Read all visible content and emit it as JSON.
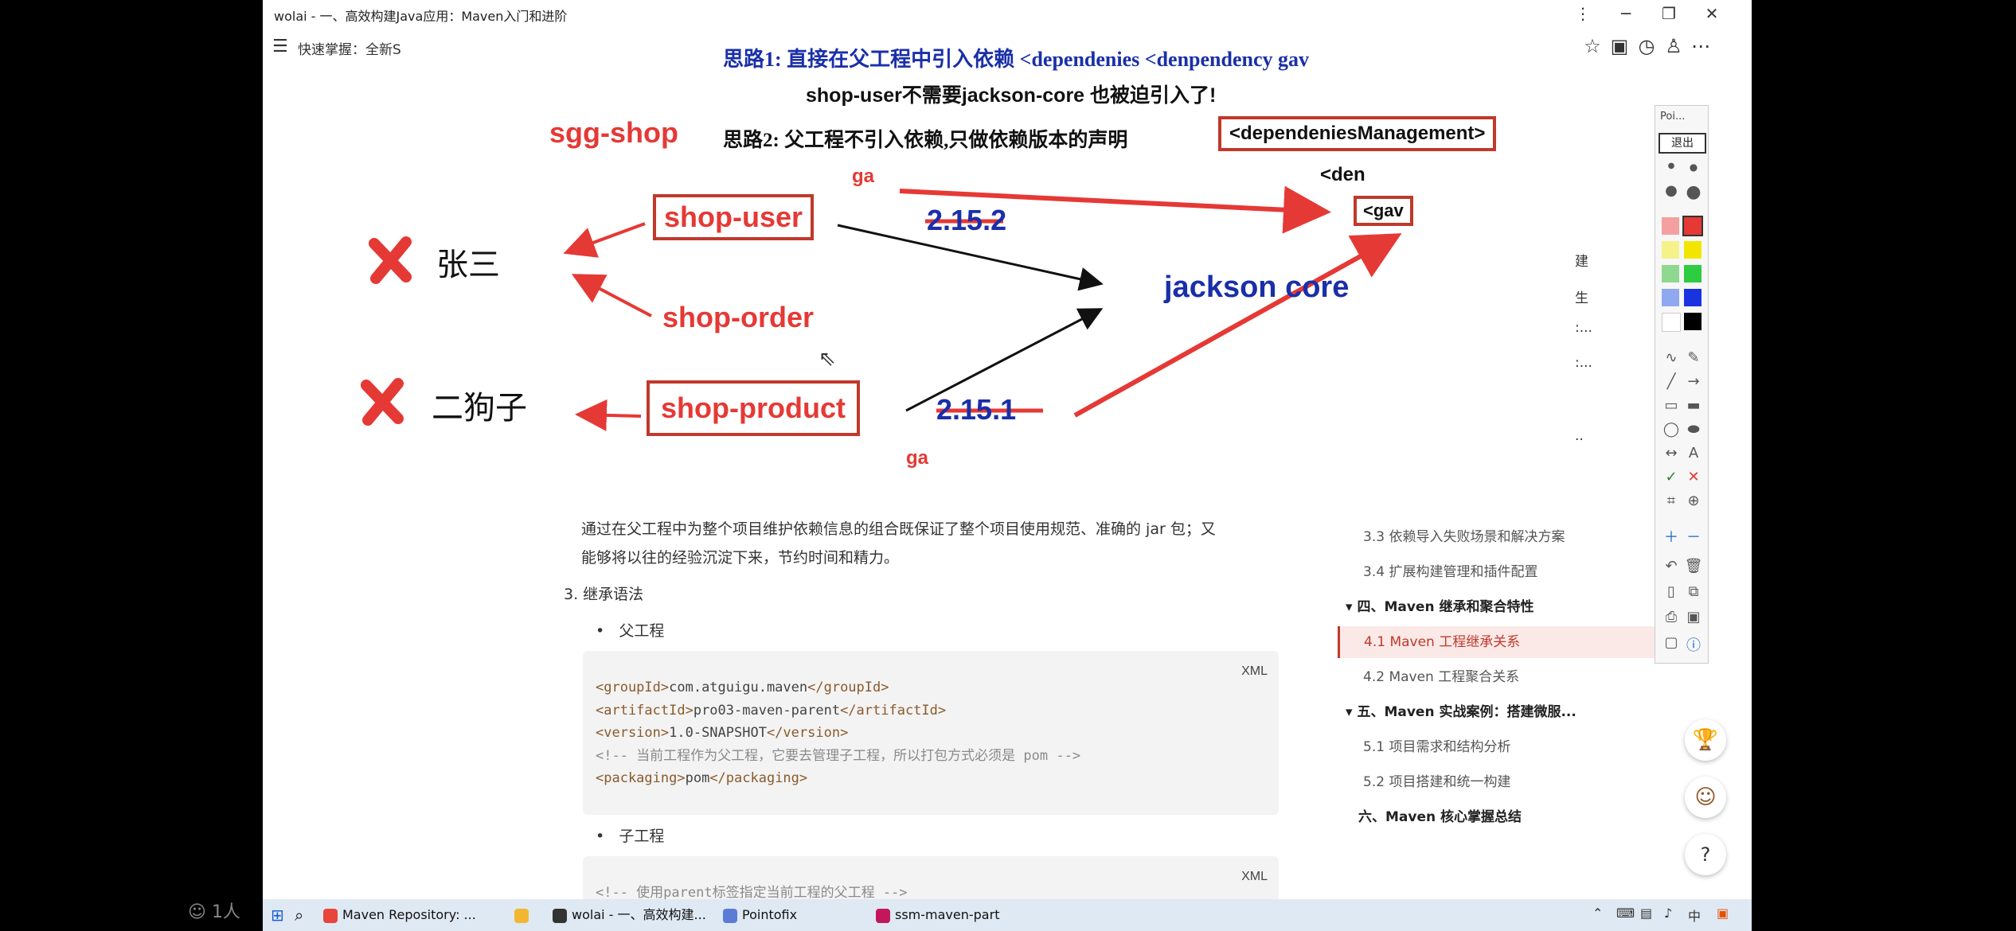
{
  "window": {
    "title": "wolai - 一、高效构建Java应用：Maven入门和进阶",
    "controls": [
      "⋮",
      "─",
      "❐",
      "✕"
    ]
  },
  "toolbar": {
    "doc_label": "快速掌握：全新S",
    "icons": [
      "star-icon",
      "comment-icon",
      "history-icon",
      "share-icon",
      "more-icon"
    ]
  },
  "annotation": {
    "idea1": "思路1: 直接在父工程中引入依赖  <dependenies  <denpendency  gav",
    "idea1_note": "shop-user不需要jackson-core 也被迫引入了!",
    "parent": "sgg-shop",
    "idea2": "思路2: 父工程不引入依赖,只做依赖版本的声明",
    "idea2_box": "<dependeniesManagement>",
    "den": "<den",
    "gav": "<gav",
    "ga_top": "ga",
    "ga_bottom": "ga",
    "modules": [
      "shop-user",
      "shop-order",
      "shop-product"
    ],
    "version_top": "2.15.2",
    "version_bottom": "2.15.1",
    "dependency": "jackson core",
    "dev1": "张三",
    "dev2": "二狗子"
  },
  "content": {
    "para_line1": "通过在父工程中为整个项目维护依赖信息的组合既保证了整个项目使用规范、准确的 jar 包；又",
    "para_line2": "能够将以往的经验沉淀下来，节约时间和精力。",
    "section": "3. 继承语法",
    "bullet_parent": "父工程",
    "bullet_child": "子工程",
    "code_lang": "XML",
    "code_lines": [
      {
        "o": "<groupId>",
        "v": "com.atguigu.maven",
        "c": "</groupId>"
      },
      {
        "o": "<artifactId>",
        "v": "pro03-maven-parent",
        "c": "</artifactId>"
      },
      {
        "o": "<version>",
        "v": "1.0-SNAPSHOT",
        "c": "</version>"
      },
      {
        "comment": "<!-- 当前工程作为父工程，它要去管理子工程，所以打包方式必须是 pom -->"
      },
      {
        "o": "<packaging>",
        "v": "pom",
        "c": "</packaging>"
      }
    ],
    "code2_lang": "XML",
    "code2_line": "<!-- 使用parent标签指定当前工程的父工程 -->"
  },
  "outline": [
    {
      "label": "3.3 依赖导入失败场景和解决方案",
      "style": "sub"
    },
    {
      "label": "3.4 扩展构建管理和插件配置",
      "style": "sub"
    },
    {
      "label": "▾ 四、Maven 继承和聚合特性",
      "style": "bold"
    },
    {
      "label": "4.1 Maven 工程继承关系",
      "style": "active"
    },
    {
      "label": "4.2 Maven 工程聚合关系",
      "style": "sub"
    },
    {
      "label": "▾ 五、Maven 实战案例：搭建微服...",
      "style": "bold"
    },
    {
      "label": "5.1 项目需求和结构分析",
      "style": "sub"
    },
    {
      "label": "5.2 项目搭建和统一构建",
      "style": "sub"
    },
    {
      "label": "六、Maven 核心掌握总结",
      "style": "bold"
    }
  ],
  "rail": [
    "建",
    "生",
    ":...",
    ":...",
    ".."
  ],
  "pointofix": {
    "header": "Poi...",
    "exit": "退出",
    "colors": [
      "#f4a0a0",
      "#e53935",
      "#f5f28a",
      "#f2e600",
      "#8fd88f",
      "#2ecc40",
      "#8fa8f0",
      "#1a33e0",
      "#ffffff",
      "#000000"
    ]
  },
  "help": "?",
  "taskbar": {
    "items": [
      {
        "label": "Maven Repository: ...",
        "color": "#e8453c"
      },
      {
        "label": "",
        "color": "#f2b731"
      },
      {
        "label": "wolai - 一、高效构建...",
        "color": "#333333"
      },
      {
        "label": "Pointofix",
        "color": "#5b7bd5"
      },
      {
        "label": "ssm-maven-part",
        "color": "#c2185b"
      }
    ]
  },
  "outside_label": "1人"
}
